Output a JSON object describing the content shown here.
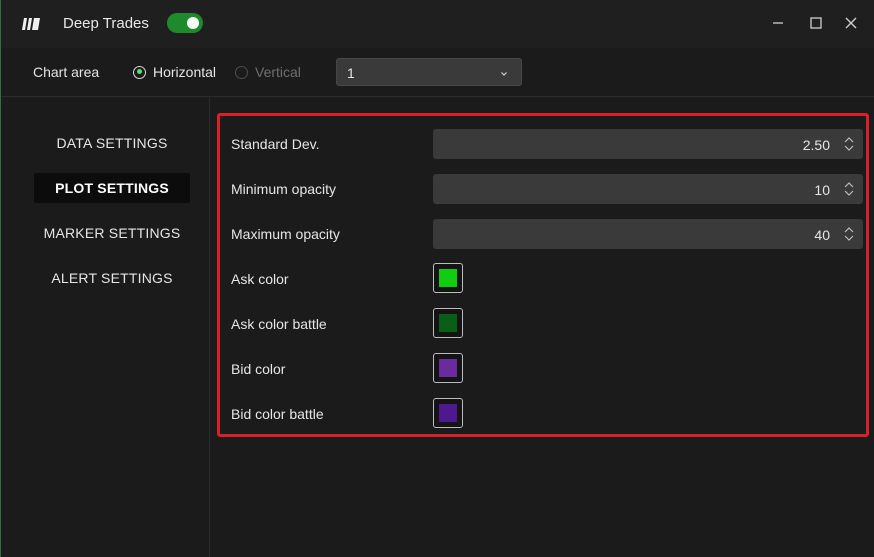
{
  "app": {
    "title": "Deep Trades",
    "toggle_on": true
  },
  "chart_area": {
    "label": "Chart area",
    "options": [
      {
        "label": "Horizontal",
        "selected": true
      },
      {
        "label": "Vertical",
        "selected": false
      }
    ],
    "select_value": "1"
  },
  "sidebar": {
    "items": [
      {
        "label": "DATA SETTINGS",
        "active": false
      },
      {
        "label": "PLOT SETTINGS",
        "active": true
      },
      {
        "label": "MARKER SETTINGS",
        "active": false
      },
      {
        "label": "ALERT SETTINGS",
        "active": false
      }
    ]
  },
  "settings": {
    "std_dev": {
      "label": "Standard Dev.",
      "value": "2.50"
    },
    "min_opacity": {
      "label": "Minimum opacity",
      "value": "10"
    },
    "max_opacity": {
      "label": "Maximum opacity",
      "value": "40"
    },
    "ask_color": {
      "label": "Ask color",
      "color": "#12cc12"
    },
    "ask_color_battle": {
      "label": "Ask color battle",
      "color": "#0b5e16"
    },
    "bid_color": {
      "label": "Bid color",
      "color": "#6b2a9e"
    },
    "bid_color_battle": {
      "label": "Bid color battle",
      "color": "#50188f"
    }
  },
  "colors": {
    "accent_green": "#1e8a2c",
    "highlight_red": "#d8202a"
  }
}
